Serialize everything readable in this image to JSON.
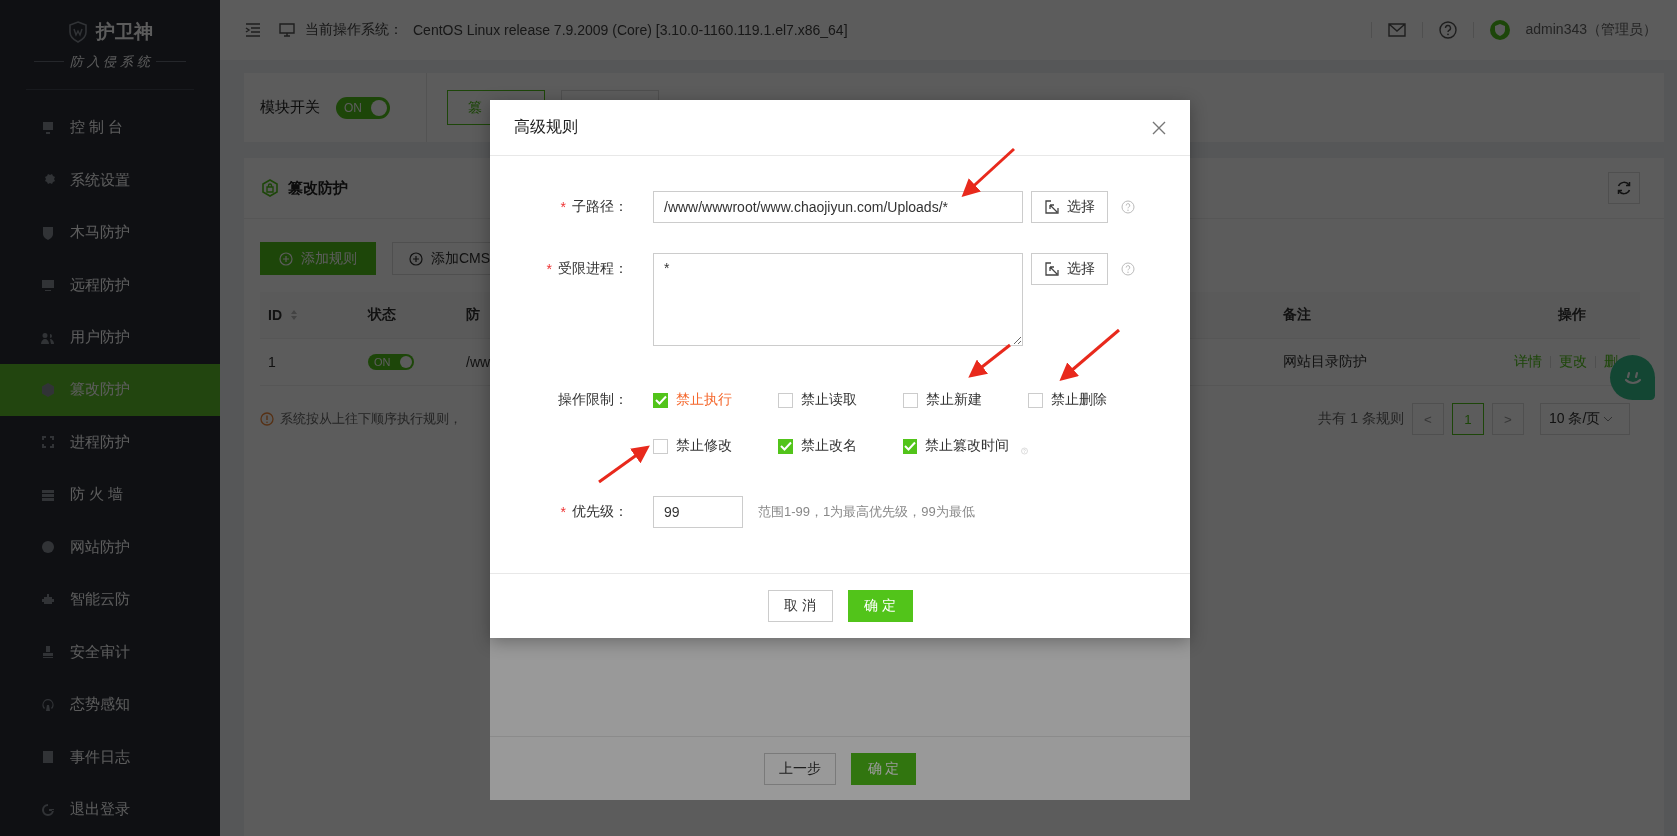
{
  "sidebar": {
    "brand": "护卫神",
    "subtitle": "防 入 侵 系 统",
    "items": [
      {
        "label": "控 制 台",
        "selected": false
      },
      {
        "label": "系统设置",
        "selected": false
      },
      {
        "label": "木马防护",
        "selected": false
      },
      {
        "label": "远程防护",
        "selected": false
      },
      {
        "label": "用户防护",
        "selected": false
      },
      {
        "label": "篡改防护",
        "selected": true
      },
      {
        "label": "进程防护",
        "selected": false
      },
      {
        "label": "防 火 墙",
        "selected": false
      },
      {
        "label": "网站防护",
        "selected": false
      },
      {
        "label": "智能云防",
        "selected": false
      },
      {
        "label": "安全审计",
        "selected": false
      },
      {
        "label": "态势感知",
        "selected": false
      },
      {
        "label": "事件日志",
        "selected": false
      },
      {
        "label": "退出登录",
        "selected": false
      }
    ]
  },
  "header": {
    "os_label": "当前操作系统：",
    "os_value": "CentOS Linux release 7.9.2009 (Core) [3.10.0-1160.119.1.el7.x86_64]",
    "user": "admin343（管理员）"
  },
  "module_bar": {
    "label": "模块开关",
    "switch": {
      "label": "ON",
      "on": true
    },
    "tabs": [
      {
        "label": "篡",
        "selected": true
      },
      {
        "selected": false
      }
    ]
  },
  "panel": {
    "title": "篡改防护",
    "buttons": [
      {
        "label": "添加规则",
        "kind": "primary"
      },
      {
        "label": "添加CMS",
        "kind": "default"
      }
    ],
    "table": {
      "columns": [
        "ID",
        "状态",
        "防",
        "备注",
        "操作"
      ],
      "rows": [
        {
          "id": "1",
          "status": {
            "label": "ON",
            "on": true
          },
          "path": "/ww",
          "note": "网站目录防护",
          "actions": [
            "详情",
            "更改",
            "删"
          ]
        }
      ]
    },
    "note": "系统按从上往下顺序执行规则，",
    "pagination": {
      "total": "共有 1 条规则",
      "prev": "<",
      "pages": [
        {
          "label": "1",
          "selected": true
        }
      ],
      "next": ">",
      "page_size": "10 条/页"
    }
  },
  "back_dialog": {
    "buttons": [
      {
        "label": "上一步",
        "kind": "default"
      },
      {
        "label": "确 定",
        "kind": "primary"
      }
    ]
  },
  "dialog": {
    "title": "高级规则",
    "fields": [
      {
        "kind": "input",
        "required_mark": "*",
        "label": "子路径：",
        "value": "/www/wwwroot/www.chaojiyun.com/Uploads/*",
        "button": "选择"
      },
      {
        "kind": "textarea",
        "required_mark": "*",
        "label": "受限进程：",
        "value": "*",
        "button": "选择"
      }
    ],
    "restrictions": {
      "label": "操作限制：",
      "options": [
        {
          "label": "禁止执行",
          "checked": true,
          "highlighted": true
        },
        {
          "label": "禁止读取",
          "checked": false,
          "highlighted": false
        },
        {
          "label": "禁止新建",
          "checked": false,
          "highlighted": false
        },
        {
          "label": "禁止删除",
          "checked": false,
          "highlighted": false
        },
        {
          "label": "禁止修改",
          "checked": false,
          "highlighted": false
        },
        {
          "label": "禁止改名",
          "checked": true,
          "highlighted": false
        },
        {
          "label": "禁止篡改时间",
          "checked": true,
          "highlighted": false
        }
      ]
    },
    "priority": {
      "required_mark": "*",
      "label": "优先级：",
      "value": "99",
      "hint": "范围1-99，1为最高优先级，99为最低"
    },
    "buttons": [
      {
        "label": "取 消",
        "kind": "default"
      },
      {
        "label": "确 定",
        "kind": "primary"
      }
    ]
  }
}
